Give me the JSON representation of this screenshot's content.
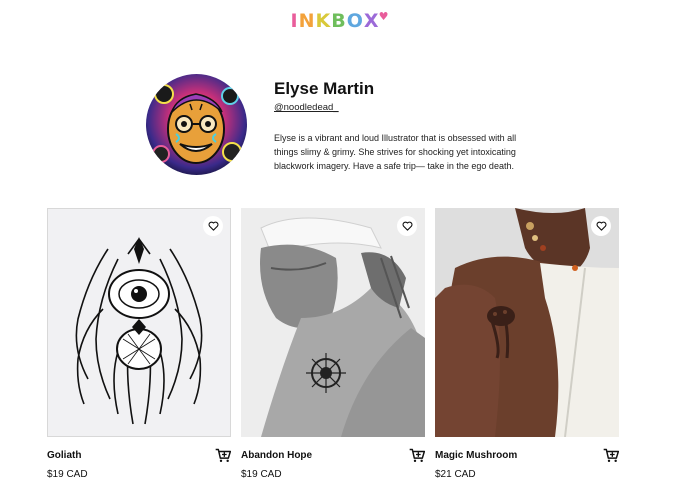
{
  "brand": {
    "logo_letters": [
      "I",
      "N",
      "K",
      "B",
      "O",
      "X"
    ],
    "logo_colors": [
      "#e95d9b",
      "#f3a23b",
      "#ece14c",
      "#6fbe5c",
      "#5fa7df",
      "#9c6ad8"
    ],
    "heart_color": "#e95d9b"
  },
  "profile": {
    "name": "Elyse Martin",
    "handle": "@noodledead_",
    "bio": "Elyse is a vibrant and loud Illustrator that is obsessed with all things slimy & grimy. She strives for shocking yet intoxicating blackwork imagery. Have a safe trip— take in the ego death."
  },
  "products": [
    {
      "title": "Goliath",
      "price": "$19 CAD",
      "image": "spider-eye-illustration"
    },
    {
      "title": "Abandon Hope",
      "price": "$19 CAD",
      "image": "shoulder-tattoo-photo"
    },
    {
      "title": "Magic Mushroom",
      "price": "$21 CAD",
      "image": "arm-mushroom-tattoo-photo"
    }
  ],
  "icons": {
    "favorite": "heart-outline-icon",
    "cart": "cart-add-icon"
  }
}
